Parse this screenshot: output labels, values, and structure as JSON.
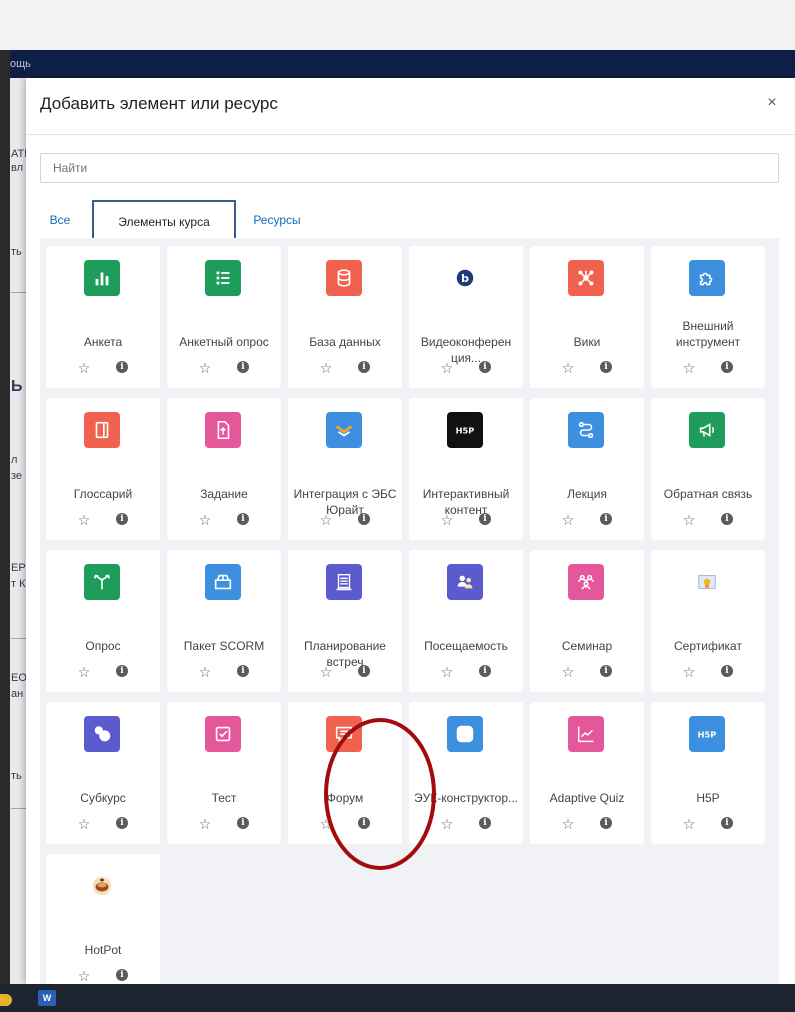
{
  "background": {
    "nav_menu": "ощь",
    "fragments": [
      "АТН",
      "вл",
      "ть",
      "Ь",
      "л",
      "зе",
      "ЕР",
      "т К",
      "ЕО",
      "ан",
      "ть"
    ]
  },
  "modal": {
    "title": "Добавить элемент или ресурс",
    "close_label": "×",
    "search_placeholder": "Найти",
    "tabs": [
      {
        "label": "Все"
      },
      {
        "label": "Элементы курса"
      },
      {
        "label": "Ресурсы"
      }
    ]
  },
  "colors": {
    "green": "#1e9c5a",
    "red": "#f0624f",
    "blue": "#3d8fe0",
    "pink": "#e5579b",
    "indigo": "#5b5bcf",
    "annotation": "#a30c0c",
    "navbar": "#0f1e46"
  },
  "items": [
    {
      "name": "Анкета",
      "icon": "chart-bars-icon",
      "color": "#1e9c5a"
    },
    {
      "name": "Анкетный опрос",
      "icon": "list-icon",
      "color": "#1e9c5a"
    },
    {
      "name": "База данных",
      "icon": "database-icon",
      "color": "#f0624f"
    },
    {
      "name": "Видеоконферен ция...",
      "icon": "bigbluebutton-icon",
      "color": "#ffffff"
    },
    {
      "name": "Вики",
      "icon": "wiki-network-icon",
      "color": "#f0624f"
    },
    {
      "name": "Внешний инструмент",
      "icon": "puzzle-icon",
      "color": "#3d8fe0"
    },
    {
      "name": "Глоссарий",
      "icon": "book-icon",
      "color": "#f0624f"
    },
    {
      "name": "Задание",
      "icon": "file-upload-icon",
      "color": "#e5579b"
    },
    {
      "name": "Интеграция с ЭБС Юрайт",
      "icon": "urait-logo-icon",
      "color": "#3d8fe0"
    },
    {
      "name": "Интерактивный контент",
      "icon": "h5p-black-icon",
      "color": "#111111"
    },
    {
      "name": "Лекция",
      "icon": "lesson-path-icon",
      "color": "#3d8fe0"
    },
    {
      "name": "Обратная связь",
      "icon": "megaphone-icon",
      "color": "#1e9c5a"
    },
    {
      "name": "Опрос",
      "icon": "choice-signpost-icon",
      "color": "#1e9c5a"
    },
    {
      "name": "Пакет SCORM",
      "icon": "package-icon",
      "color": "#3d8fe0"
    },
    {
      "name": "Планирование встреч",
      "icon": "scheduler-icon",
      "color": "#5b5bcf"
    },
    {
      "name": "Посещаемость",
      "icon": "attendance-icon",
      "color": "#5b5bcf"
    },
    {
      "name": "Семинар",
      "icon": "workshop-icon",
      "color": "#e5579b"
    },
    {
      "name": "Сертификат",
      "icon": "certificate-icon",
      "color": "#ffffff"
    },
    {
      "name": "Субкурс",
      "icon": "subcourse-icon",
      "color": "#5b5bcf"
    },
    {
      "name": "Тест",
      "icon": "quiz-check-icon",
      "color": "#e5579b"
    },
    {
      "name": "Форум",
      "icon": "forum-speech-icon",
      "color": "#f0624f"
    },
    {
      "name": "ЭУК-конструктор...",
      "icon": "rounded-square-icon",
      "color": "#3d8fe0"
    },
    {
      "name": "Adaptive Quiz",
      "icon": "line-graph-icon",
      "color": "#e5579b"
    },
    {
      "name": "H5P",
      "icon": "h5p-blue-icon",
      "color": "#3d8fe0"
    },
    {
      "name": "HotPot",
      "icon": "hotpot-icon",
      "color": "#ffffff"
    }
  ],
  "actions": {
    "star": "☆",
    "info": "i"
  }
}
